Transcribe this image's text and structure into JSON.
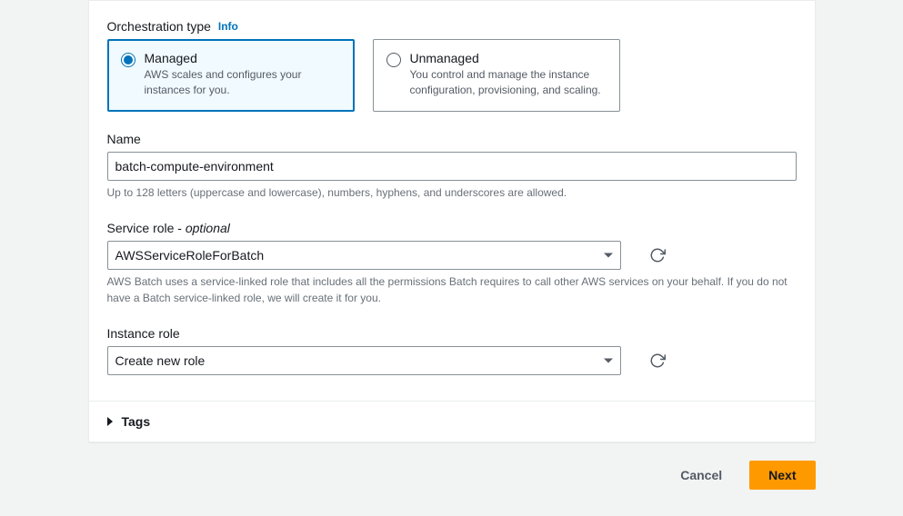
{
  "orchestration": {
    "label": "Orchestration type",
    "info": "Info",
    "managed": {
      "title": "Managed",
      "desc": "AWS scales and configures your instances for you."
    },
    "unmanaged": {
      "title": "Unmanaged",
      "desc": "You control and manage the instance configuration, provisioning, and scaling."
    }
  },
  "name": {
    "label": "Name",
    "value": "batch-compute-environment",
    "helper": "Up to 128 letters (uppercase and lowercase), numbers, hyphens, and underscores are allowed."
  },
  "serviceRole": {
    "labelPrefix": "Service role - ",
    "optional": "optional",
    "value": "AWSServiceRoleForBatch",
    "helper": "AWS Batch uses a service-linked role that includes all the permissions Batch requires to call other AWS services on your behalf. If you do not have a Batch service-linked role, we will create it for you."
  },
  "instanceRole": {
    "label": "Instance role",
    "value": "Create new role"
  },
  "tags": {
    "label": "Tags"
  },
  "footer": {
    "cancel": "Cancel",
    "next": "Next"
  }
}
